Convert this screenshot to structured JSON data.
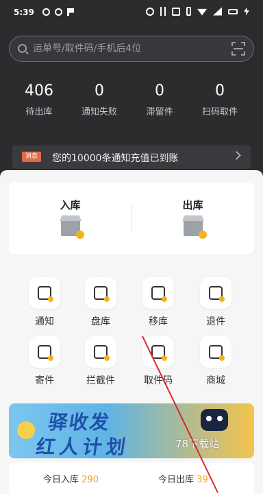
{
  "status_bar": {
    "time": "5:39",
    "left_icons": [
      "notification-icon",
      "notification-icon",
      "flag-icon"
    ],
    "right_icons": [
      "alarm-icon",
      "bluetooth-icon",
      "nfc-icon",
      "vibrate-icon",
      "wifi-icon",
      "signal-icon",
      "battery-icon",
      "charging-icon"
    ]
  },
  "search": {
    "placeholder": "运单号/取件码/手机后4位"
  },
  "stats": [
    {
      "value": "406",
      "label": "待出库"
    },
    {
      "value": "0",
      "label": "通知失败"
    },
    {
      "value": "0",
      "label": "滞留件"
    },
    {
      "value": "0",
      "label": "扫码取件"
    }
  ],
  "notice": {
    "badge": "消息",
    "text": "您的10000条通知充值已到账"
  },
  "inout": {
    "in_label": "入库",
    "out_label": "出库"
  },
  "grid": [
    {
      "label": "通知",
      "icon": "speaker-icon"
    },
    {
      "label": "盘库",
      "icon": "inventory-icon"
    },
    {
      "label": "移库",
      "icon": "move-icon"
    },
    {
      "label": "退件",
      "icon": "return-icon"
    },
    {
      "label": "寄件",
      "icon": "send-icon"
    },
    {
      "label": "拦截件",
      "icon": "intercept-icon"
    },
    {
      "label": "取件码",
      "icon": "pickup-code-icon"
    },
    {
      "label": "商城",
      "icon": "shop-icon"
    }
  ],
  "banner": {
    "line1": "驿收发",
    "line2": "红人计划"
  },
  "watermark": "78下载站",
  "today": {
    "in_label": "今日入库",
    "in_value": "290",
    "out_label": "今日出库",
    "out_value": "39"
  },
  "colors": {
    "header_bg": "#2c2c2f",
    "accent": "#f5b21a",
    "badge": "#e46a44",
    "annotation_line": "#d8282a"
  }
}
